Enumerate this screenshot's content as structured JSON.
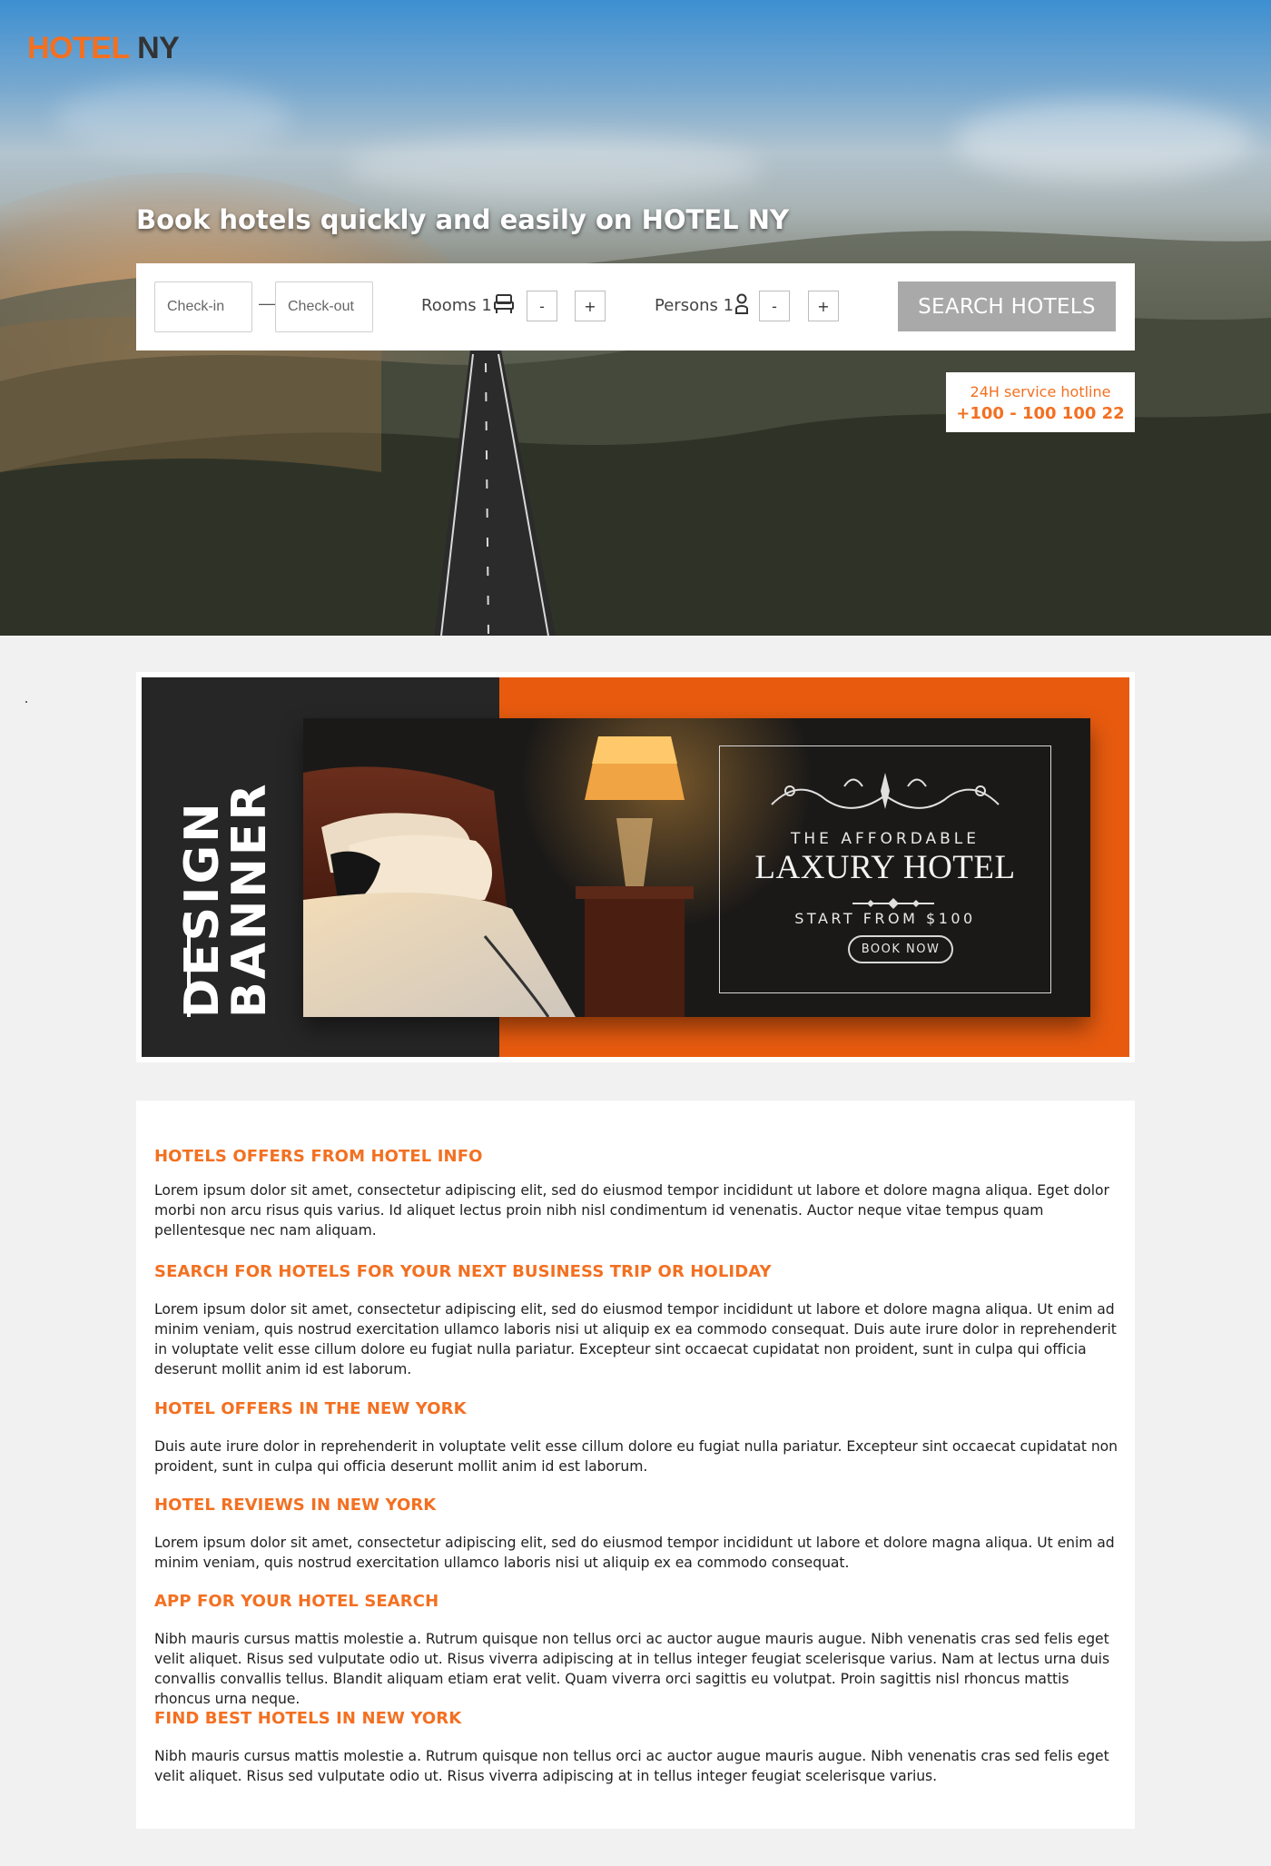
{
  "header": {
    "logo_part1": "HOTEL",
    "logo_part2": "NY",
    "tagline": "Book hotels quickly and easily on HOTEL NY"
  },
  "search": {
    "checkin_placeholder": "Check-in",
    "checkout_placeholder": "Check-out",
    "date_separator": "—",
    "rooms_label": "Rooms 1",
    "persons_label": "Persons 1",
    "minus": "-",
    "plus": "+",
    "button_label": "SEARCH HOTELS"
  },
  "hotline": {
    "label": "24H service hotline",
    "number": "+100 - 100 100 22"
  },
  "banner": {
    "vertical_line1": "DESIGN",
    "vertical_line2": "BANNER",
    "subtitle": "THE AFFORDABLE",
    "title": "LAXURY HOTEL",
    "price": "START FROM $100",
    "button": "BOOK NOW"
  },
  "colors": {
    "accent": "#f37021",
    "search_button": "#a9a9a9",
    "banner_orange": "#e85b0f",
    "banner_dark": "#262626"
  },
  "sections": [
    {
      "heading": "HOTELS OFFERS FROM HOTEL INFO",
      "text": "Lorem ipsum dolor sit amet, consectetur adipiscing elit, sed do eiusmod tempor incididunt ut labore et dolore magna aliqua. Eget dolor morbi non arcu risus quis varius. Id aliquet lectus proin nibh nisl condimentum id venenatis. Auctor neque vitae tempus quam pellentesque nec nam aliquam."
    },
    {
      "heading": "SEARCH FOR HOTELS FOR YOUR NEXT BUSINESS TRIP OR HOLIDAY",
      "text": "Lorem ipsum dolor sit amet, consectetur adipiscing elit, sed do eiusmod tempor incididunt ut labore et dolore magna aliqua. Ut enim ad minim veniam, quis nostrud exercitation ullamco laboris nisi ut aliquip ex ea commodo consequat. Duis aute irure dolor in reprehenderit in voluptate velit esse cillum dolore eu fugiat nulla pariatur. Excepteur sint occaecat cupidatat non proident, sunt in culpa qui officia deserunt mollit anim id est laborum."
    },
    {
      "heading": "HOTEL OFFERS IN THE NEW YORK",
      "text": "Duis aute irure dolor in reprehenderit in voluptate velit esse cillum dolore eu fugiat nulla pariatur. Excepteur sint occaecat cupidatat non proident, sunt in culpa qui officia deserunt mollit anim id est laborum."
    },
    {
      "heading": "HOTEL REVIEWS IN NEW YORK",
      "text": "Lorem ipsum dolor sit amet, consectetur adipiscing elit, sed do eiusmod tempor incididunt ut labore et dolore magna aliqua. Ut enim ad minim veniam, quis nostrud exercitation ullamco laboris nisi ut aliquip ex ea commodo consequat."
    },
    {
      "heading": "APP FOR YOUR HOTEL SEARCH",
      "text": "Nibh mauris cursus mattis molestie a. Rutrum quisque non tellus orci ac auctor augue mauris augue. Nibh venenatis cras sed felis eget velit aliquet. Risus sed vulputate odio ut. Risus viverra adipiscing at in tellus integer feugiat scelerisque varius. Nam at lectus urna duis convallis convallis tellus. Blandit aliquam etiam erat velit. Quam viverra orci sagittis eu volutpat. Proin sagittis nisl rhoncus mattis rhoncus urna neque."
    },
    {
      "heading": "FIND BEST HOTELS IN NEW YORK",
      "text": "Nibh mauris cursus mattis molestie a. Rutrum quisque non tellus orci ac auctor augue mauris augue. Nibh venenatis cras sed felis eget velit aliquet. Risus sed vulputate odio ut. Risus viverra adipiscing at in tellus integer feugiat scelerisque varius."
    }
  ]
}
